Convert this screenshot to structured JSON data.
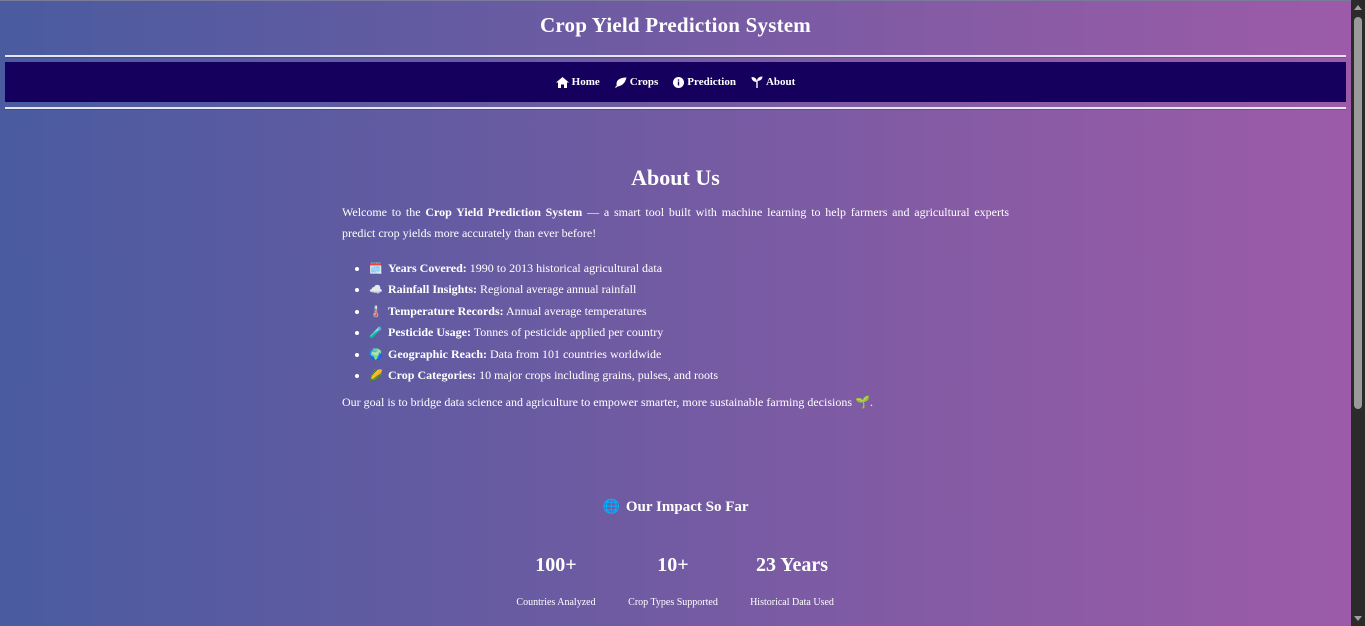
{
  "header": {
    "title": "Crop Yield Prediction System"
  },
  "nav": {
    "items": [
      {
        "label": "Home",
        "icon": "home-icon"
      },
      {
        "label": "Crops",
        "icon": "leaf-icon"
      },
      {
        "label": "Prediction",
        "icon": "info-icon"
      },
      {
        "label": "About",
        "icon": "seedling-icon"
      }
    ]
  },
  "about": {
    "title": "About Us",
    "intro_prefix": "Welcome to the ",
    "intro_bold": "Crop Yield Prediction System",
    "intro_suffix": " — a smart tool built with machine learning to help farmers and agricultural experts predict crop yields more accurately than ever before!",
    "features": [
      {
        "emoji": "🗓️",
        "key": "Years Covered:",
        "text": " 1990 to 2013 historical agricultural data"
      },
      {
        "emoji": "☁️",
        "key": "Rainfall Insights:",
        "text": " Regional average annual rainfall"
      },
      {
        "emoji": "🌡️",
        "key": "Temperature Records:",
        "text": " Annual average temperatures"
      },
      {
        "emoji": "🧪",
        "key": "Pesticide Usage:",
        "text": " Tonnes of pesticide applied per country"
      },
      {
        "emoji": "🌍",
        "key": "Geographic Reach:",
        "text": " Data from 101 countries worldwide"
      },
      {
        "emoji": "🌽",
        "key": "Crop Categories:",
        "text": " 10 major crops including grains, pulses, and roots"
      }
    ],
    "goal_text": "Our goal is to bridge data science and agriculture to empower smarter, more sustainable farming decisions",
    "goal_emoji": "🌱",
    "goal_end": "."
  },
  "impact": {
    "emoji": "🌐",
    "title": "Our Impact So Far",
    "stats": [
      {
        "value": "100+",
        "label": "Countries Analyzed"
      },
      {
        "value": "10+",
        "label": "Crop Types Supported"
      },
      {
        "value": "23 Years",
        "label": "Historical Data Used"
      }
    ]
  }
}
